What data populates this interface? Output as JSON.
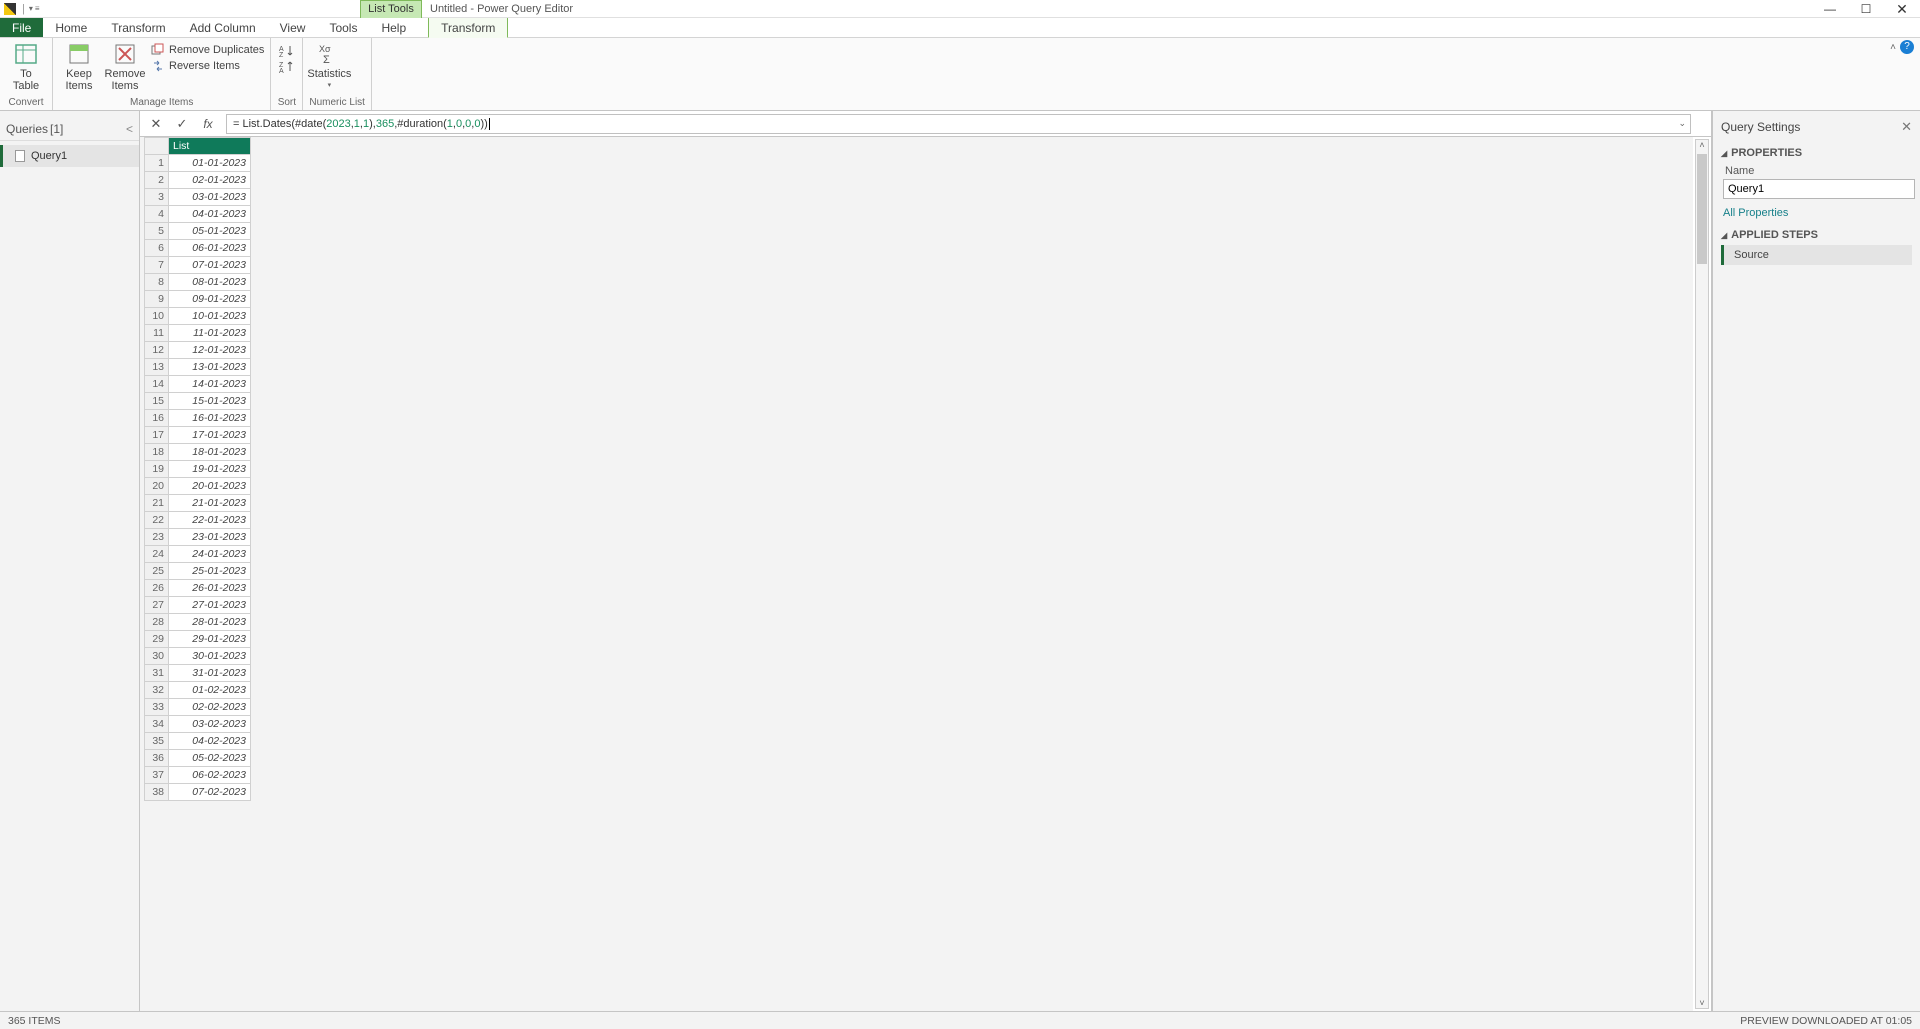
{
  "titlebar": {
    "context_tab": "List Tools",
    "app_title": "Untitled - Power Query Editor"
  },
  "tabs": {
    "file": "File",
    "home": "Home",
    "transform": "Transform",
    "addcol": "Add Column",
    "view": "View",
    "tools": "Tools",
    "help": "Help",
    "ctx_transform": "Transform"
  },
  "ribbon": {
    "convert": {
      "to_table": "To\nTable",
      "label": "Convert"
    },
    "manage": {
      "keep": "Keep\nItems",
      "remove": "Remove\nItems",
      "remdup": "Remove Duplicates",
      "reverse": "Reverse Items",
      "label": "Manage Items"
    },
    "sort": {
      "label": "Sort"
    },
    "numeric": {
      "stats": "Statistics",
      "label": "Numeric List"
    }
  },
  "queries": {
    "title": "Queries",
    "count": "[1]",
    "item": "Query1"
  },
  "formula": {
    "prefix": "= List.Dates(#date(",
    "y": "2023",
    "c1": ",",
    "m": "1",
    "c2": ",",
    "d": "1",
    "mid": "),",
    "n": "365",
    "mid2": ",#duration(",
    "a": "1",
    "c3": ",",
    "b": "0",
    "c4": ",",
    "cc": "0",
    "c5": ",",
    "dd": "0",
    "suffix": "))"
  },
  "column_header": "List",
  "rows": [
    {
      "n": "1",
      "v": "01-01-2023"
    },
    {
      "n": "2",
      "v": "02-01-2023"
    },
    {
      "n": "3",
      "v": "03-01-2023"
    },
    {
      "n": "4",
      "v": "04-01-2023"
    },
    {
      "n": "5",
      "v": "05-01-2023"
    },
    {
      "n": "6",
      "v": "06-01-2023"
    },
    {
      "n": "7",
      "v": "07-01-2023"
    },
    {
      "n": "8",
      "v": "08-01-2023"
    },
    {
      "n": "9",
      "v": "09-01-2023"
    },
    {
      "n": "10",
      "v": "10-01-2023"
    },
    {
      "n": "11",
      "v": "11-01-2023"
    },
    {
      "n": "12",
      "v": "12-01-2023"
    },
    {
      "n": "13",
      "v": "13-01-2023"
    },
    {
      "n": "14",
      "v": "14-01-2023"
    },
    {
      "n": "15",
      "v": "15-01-2023"
    },
    {
      "n": "16",
      "v": "16-01-2023"
    },
    {
      "n": "17",
      "v": "17-01-2023"
    },
    {
      "n": "18",
      "v": "18-01-2023"
    },
    {
      "n": "19",
      "v": "19-01-2023"
    },
    {
      "n": "20",
      "v": "20-01-2023"
    },
    {
      "n": "21",
      "v": "21-01-2023"
    },
    {
      "n": "22",
      "v": "22-01-2023"
    },
    {
      "n": "23",
      "v": "23-01-2023"
    },
    {
      "n": "24",
      "v": "24-01-2023"
    },
    {
      "n": "25",
      "v": "25-01-2023"
    },
    {
      "n": "26",
      "v": "26-01-2023"
    },
    {
      "n": "27",
      "v": "27-01-2023"
    },
    {
      "n": "28",
      "v": "28-01-2023"
    },
    {
      "n": "29",
      "v": "29-01-2023"
    },
    {
      "n": "30",
      "v": "30-01-2023"
    },
    {
      "n": "31",
      "v": "31-01-2023"
    },
    {
      "n": "32",
      "v": "01-02-2023"
    },
    {
      "n": "33",
      "v": "02-02-2023"
    },
    {
      "n": "34",
      "v": "03-02-2023"
    },
    {
      "n": "35",
      "v": "04-02-2023"
    },
    {
      "n": "36",
      "v": "05-02-2023"
    },
    {
      "n": "37",
      "v": "06-02-2023"
    },
    {
      "n": "38",
      "v": "07-02-2023"
    }
  ],
  "settings": {
    "title": "Query Settings",
    "properties": "PROPERTIES",
    "name_label": "Name",
    "name_value": "Query1",
    "all_props": "All Properties",
    "applied": "APPLIED STEPS",
    "step": "Source"
  },
  "status": {
    "left": "365 ITEMS",
    "right": "PREVIEW DOWNLOADED AT 01:05"
  }
}
